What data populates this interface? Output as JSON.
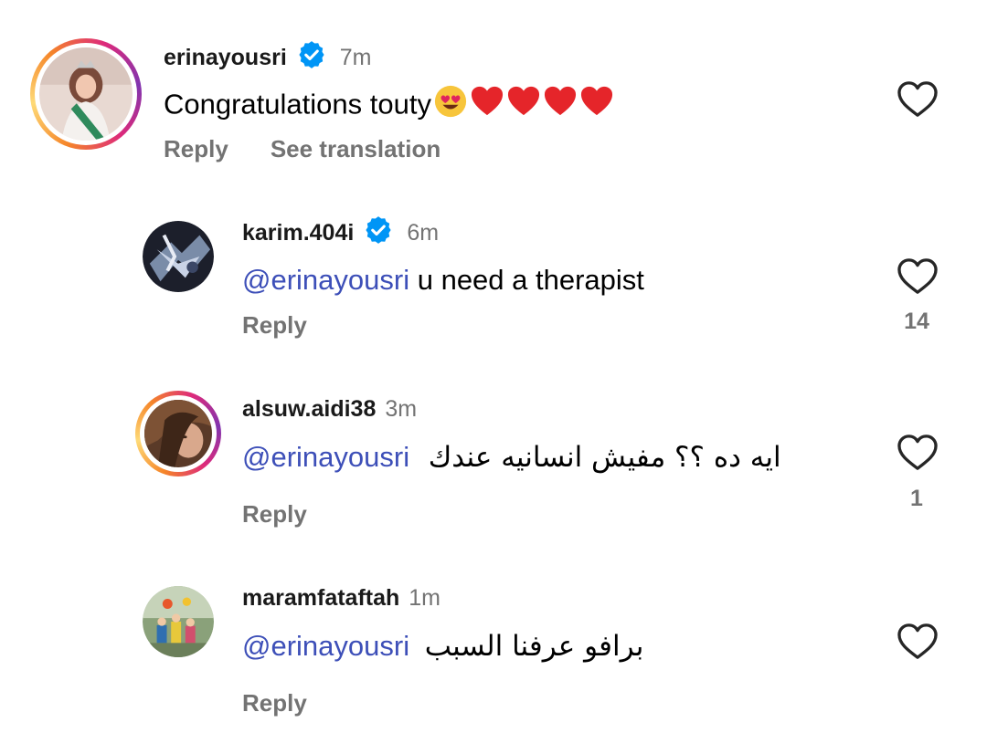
{
  "comments": [
    {
      "username": "erinayousri",
      "verified": true,
      "time": "7m",
      "text": "Congratulations touty",
      "emojis": [
        "smiling-face-with-heart-eyes",
        "red-heart",
        "red-heart",
        "red-heart",
        "red-heart"
      ],
      "actions": [
        "Reply",
        "See translation"
      ]
    },
    {
      "username": "karim.404i",
      "verified": true,
      "time": "6m",
      "mention": "@erinayousri",
      "text": "u need a therapist",
      "actions": [
        "Reply"
      ],
      "likes": "14"
    },
    {
      "username": "alsuw.aidi38",
      "verified": false,
      "time": "3m",
      "mention": "@erinayousri",
      "text": "ايه ده ؟؟ مفيش انسانيه عندك",
      "actions": [
        "Reply"
      ],
      "likes": "1"
    },
    {
      "username": "maramfataftah",
      "verified": false,
      "time": "1m",
      "mention": "@erinayousri",
      "text": "برافو عرفنا السبب",
      "actions": [
        "Reply"
      ]
    }
  ],
  "colors": {
    "mention": "#3d4fb8",
    "verified": "#0095f6",
    "muted": "#737373"
  }
}
